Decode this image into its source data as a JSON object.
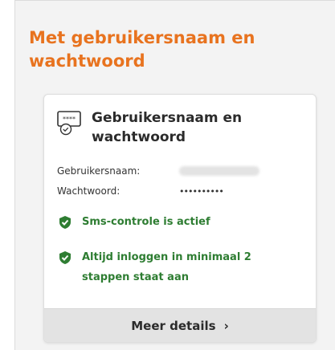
{
  "section": {
    "title": "Met gebruikersnaam en wachtwoord"
  },
  "card": {
    "icon": "password-terminal-icon",
    "title": "Gebruikersnaam en wachtwoord",
    "username_label": "Gebruikersnaam:",
    "password_label": "Wachtwoord:",
    "password_value": "••••••••••",
    "statuses": [
      {
        "icon": "shield-check-icon",
        "text": "Sms-controle is actief"
      },
      {
        "icon": "shield-check-icon",
        "text": "Altijd inloggen in minimaal 2 stappen staat aan"
      }
    ],
    "details_label": "Meer details",
    "details_icon": "chevron-right-icon"
  },
  "colors": {
    "accent": "#e8731f",
    "success": "#2e7d32",
    "panel_bg": "#f3f3f3",
    "button_bg": "#e3e3e3"
  }
}
